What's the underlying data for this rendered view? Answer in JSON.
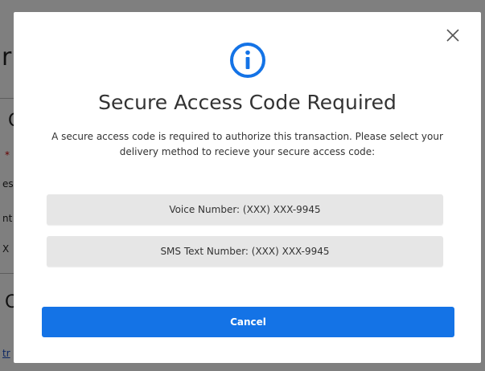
{
  "colors": {
    "accent": "#1473e6",
    "option_bg": "#e6e6e6",
    "text": "#333333"
  },
  "background": {
    "fragments": [
      "r",
      "C",
      "*",
      "es",
      "nt",
      "X",
      "C",
      "tr"
    ]
  },
  "modal": {
    "icon": "info-icon",
    "close_icon": "close-icon",
    "title": "Secure Access Code Required",
    "message": "A secure access code is required to authorize this transaction. Please select your delivery method to recieve your secure access code:",
    "options": [
      {
        "label": "Voice Number: (XXX) XXX-9945"
      },
      {
        "label": "SMS Text Number: (XXX) XXX-9945"
      }
    ],
    "cancel_label": "Cancel"
  }
}
